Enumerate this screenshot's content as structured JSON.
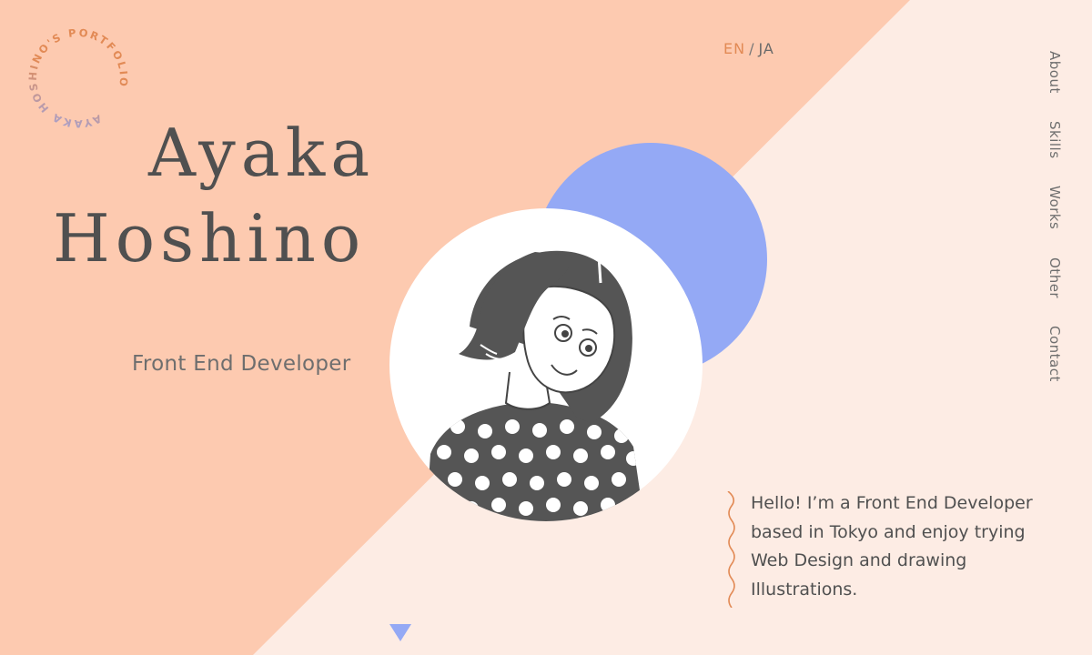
{
  "logo": {
    "ring_text": "AYAKA HOSHINO'S PORTFOLIO",
    "icon": "circular-text-logo"
  },
  "language": {
    "active": "EN",
    "separator": "/",
    "other": "JA"
  },
  "hero": {
    "first_name": "Ayaka",
    "last_name": "Hoshino",
    "role": "Front End Developer"
  },
  "nav": {
    "items": [
      {
        "label": "About"
      },
      {
        "label": "Skills"
      },
      {
        "label": "Works"
      },
      {
        "label": "Other"
      },
      {
        "label": "Contact"
      }
    ]
  },
  "intro": {
    "text": "Hello! I’m a Front End Developer based in Tokyo and enjoy trying Web Design and drawing Illustrations."
  },
  "icons": {
    "portrait": "illustrated-portrait-avatar",
    "scroll": "triangle-down-icon",
    "wave": "wavy-line-decoration"
  },
  "colors": {
    "peach": "#fdcab0",
    "light_peach": "#fdece4",
    "blue": "#94a9f5",
    "orange_accent": "#e28a55",
    "text_dark": "#505050"
  }
}
